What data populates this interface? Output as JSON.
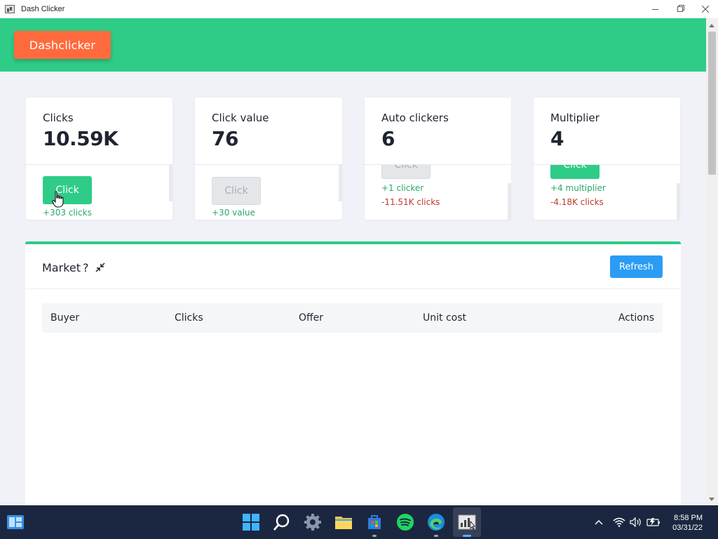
{
  "window": {
    "title": "Dash Clicker"
  },
  "header": {
    "brand": "Dashclicker"
  },
  "cards": [
    {
      "label": "Clicks",
      "value": "10.59K",
      "button": "Click",
      "lines": [
        "+303 clicks"
      ]
    },
    {
      "label": "Click value",
      "value": "76",
      "button": "Click",
      "lines": [
        "+30 value"
      ]
    },
    {
      "label": "Auto clickers",
      "value": "6",
      "button": "Click",
      "lines": [
        "+1 clicker",
        "-11.51K clicks"
      ]
    },
    {
      "label": "Multiplier",
      "value": "4",
      "button": "Click",
      "lines": [
        "+4 multiplier",
        "-4.18K clicks"
      ]
    }
  ],
  "market": {
    "title": "Market",
    "help": "?",
    "refresh": "Refresh",
    "columns": [
      "Buyer",
      "Clicks",
      "Offer",
      "Unit cost",
      "Actions"
    ]
  },
  "taskbar": {
    "time": "8:58 PM",
    "date": "03/31/22"
  },
  "colors": {
    "header": "#2ecc87",
    "brand": "#ff6a3d",
    "accent_green": "#2ecc87",
    "refresh_blue": "#2b9cf4",
    "positive": "#28a869",
    "negative": "#c0392b"
  }
}
